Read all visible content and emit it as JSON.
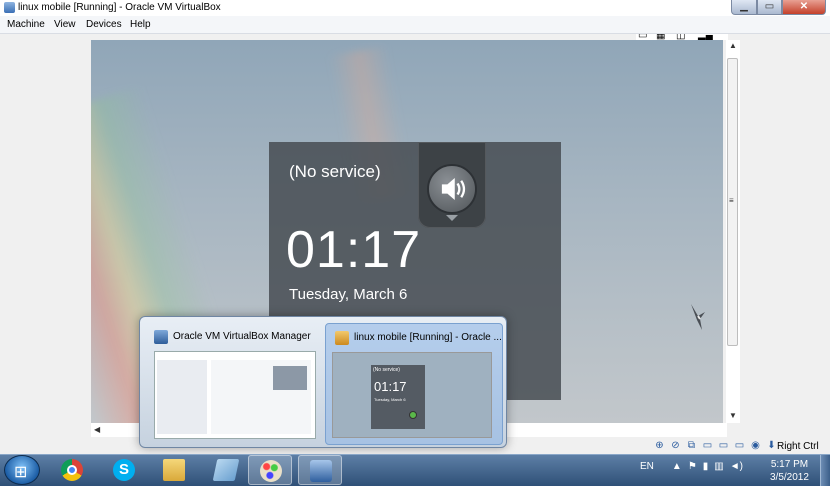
{
  "window": {
    "title": "linux mobile [Running] - Oracle VM VirtualBox",
    "controls": {
      "minimize": "▁",
      "maximize": "▭",
      "close": "✕"
    }
  },
  "menu": [
    "Machine",
    "View",
    "Devices",
    "Help"
  ],
  "vm_screen": {
    "topright_icons": [
      "screen-rotate-icon",
      "grid-icon",
      "notification-icon",
      "signal-icon"
    ],
    "lock_screen": {
      "status": "(No service)",
      "time": "01:17",
      "date": "Tuesday, March 6",
      "sound_icon": "speaker-icon"
    }
  },
  "statusbar": {
    "icons": [
      "hard-disk-icon",
      "optical-drive-icon",
      "network-icon",
      "usb-icon",
      "shared-folder-icon",
      "display-icon",
      "mouse-integration-icon",
      "keyboard-capture-icon"
    ],
    "host_key": "Right Ctrl"
  },
  "peek": {
    "windows": [
      {
        "title": "Oracle VM VirtualBox Manager"
      },
      {
        "title": "linux mobile [Running] - Oracle ..."
      }
    ],
    "thumb_lock": {
      "status": "(No service)",
      "time": "01:17",
      "date": "Tuesday, March 6"
    }
  },
  "taskbar": {
    "items": [
      {
        "name": "chrome",
        "label": "Google Chrome"
      },
      {
        "name": "skype",
        "label": "Skype"
      },
      {
        "name": "explorer",
        "label": "Windows Explorer"
      },
      {
        "name": "notes",
        "label": "Notes"
      },
      {
        "name": "paint",
        "label": "Paint"
      },
      {
        "name": "virtualbox",
        "label": "Oracle VM VirtualBox"
      }
    ],
    "language": "EN",
    "time": "5:17 PM",
    "date": "3/5/2012"
  },
  "colors": {
    "taskbar": "#2f5077",
    "lock_panel": "#464c52",
    "wallpaper": "#a6b5c1"
  }
}
